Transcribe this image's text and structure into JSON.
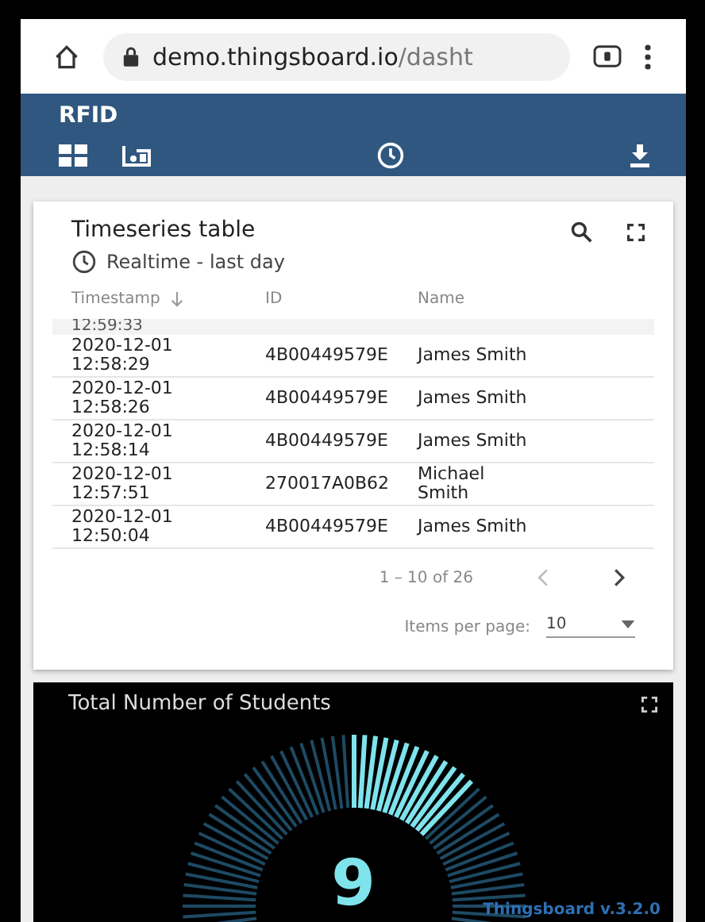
{
  "browser": {
    "url_host": "demo.thingsboard.io",
    "url_path": "/dasht"
  },
  "toolbar": {
    "title": "RFID"
  },
  "table_widget": {
    "title": "Timeseries table",
    "timewindow": "Realtime - last day",
    "columns": [
      "Timestamp",
      "ID",
      "Name"
    ],
    "partial_row": {
      "timestamp": "12:59:33"
    },
    "rows": [
      {
        "date": "2020-12-01",
        "time": "12:58:29",
        "id": "4B00449579E",
        "name": "James Smith"
      },
      {
        "date": "2020-12-01",
        "time": "12:58:26",
        "id": "4B00449579E",
        "name": "James Smith"
      },
      {
        "date": "2020-12-01",
        "time": "12:58:14",
        "id": "4B00449579E",
        "name": "James Smith"
      },
      {
        "date": "2020-12-01",
        "time": "12:57:51",
        "id": "270017A0B62",
        "name": "Michael Smith"
      },
      {
        "date": "2020-12-01",
        "time": "12:50:04",
        "id": "4B00449579E",
        "name": "James Smith"
      }
    ],
    "range": "1 – 10 of 26",
    "items_per_page_label": "Items per page:",
    "items_per_page": "10"
  },
  "gauge_widget": {
    "title": "Total Number of Students",
    "value": "9",
    "footer": "Thingsboard v.3.2.0"
  }
}
